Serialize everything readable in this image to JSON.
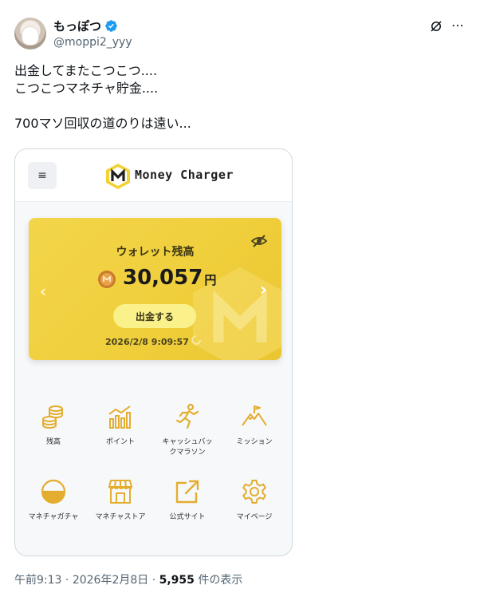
{
  "author": {
    "display_name": "もっぽつ",
    "handle": "@moppi2_yyy"
  },
  "tweet": {
    "text": "出金してまたこつこつ....\nこつこつマネチャ貯金....\n\n700マソ回収の道のりは遠い..."
  },
  "app": {
    "logo_text": "Money Charger",
    "wallet": {
      "title": "ウォレット残高",
      "balance": "30,057",
      "unit": "円",
      "withdraw_label": "出金する",
      "updated_at": "2026/2/8 9:09:57"
    },
    "menu": [
      {
        "label": "残高",
        "icon": "coins-icon"
      },
      {
        "label": "ポイント",
        "icon": "chart-icon"
      },
      {
        "label": "キャッシュバッ\nクマラソン",
        "icon": "runner-icon"
      },
      {
        "label": "ミッション",
        "icon": "mountain-flag-icon"
      },
      {
        "label": "マネチャガチャ",
        "icon": "gacha-icon"
      },
      {
        "label": "マネチャストア",
        "icon": "store-icon"
      },
      {
        "label": "公式サイト",
        "icon": "external-link-icon"
      },
      {
        "label": "マイページ",
        "icon": "gear-icon"
      }
    ]
  },
  "meta": {
    "time": "午前9:13",
    "date": "2026年2月8日",
    "views": "5,955",
    "views_suffix": "件の表示"
  },
  "colors": {
    "accent": "#f0cf3c",
    "icon": "#e3ad2f",
    "verified": "#1d9bf0"
  }
}
